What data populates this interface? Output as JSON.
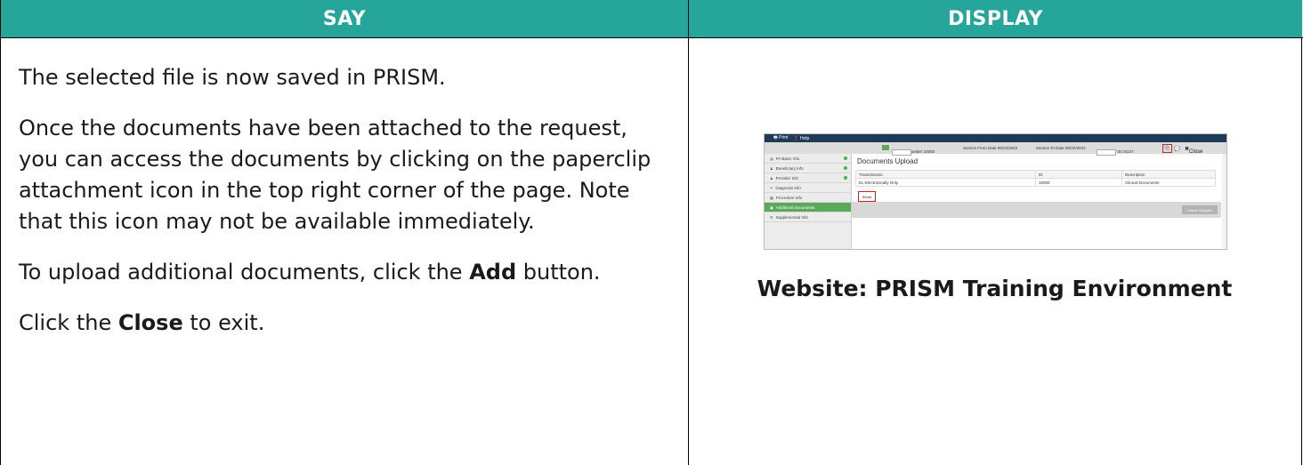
{
  "headers": {
    "say": "SAY",
    "display": "DISPLAY"
  },
  "say": {
    "p1": "The selected file is now saved in PRISM.",
    "p2": "Once the documents have been attached to the request, you can access the documents by clicking on the paperclip attachment icon in the top right corner of the page. Note that this icon may not be available immediately.",
    "p3_pre": "To upload additional documents, click the ",
    "p3_bold": "Add",
    "p3_post": " button.",
    "p4_pre": "Click the ",
    "p4_bold": "Close",
    "p4_post": " to exit."
  },
  "screenshot": {
    "print": "Print",
    "help": "Help",
    "tracking": "Tracking Number 10000",
    "service_from": "Service From Date 08/22/2022",
    "service_to": "Service To Date 08/22/2022",
    "beneficiary": "Beneficiary ID 04127",
    "close": "Close",
    "sidebar": [
      {
        "label": "PA Basic Info",
        "icon": "file-icon",
        "check": true,
        "active": false
      },
      {
        "label": "Beneficiary Info",
        "icon": "user-icon",
        "check": true,
        "active": false
      },
      {
        "label": "Provider Info",
        "icon": "users-icon",
        "check": true,
        "active": false
      },
      {
        "label": "Diagnosis Info",
        "icon": "diagnosis-icon",
        "check": false,
        "active": false
      },
      {
        "label": "Procedure Info",
        "icon": "procedure-icon",
        "check": false,
        "active": false
      },
      {
        "label": "Additional Documents",
        "icon": "documents-icon",
        "check": false,
        "active": true
      },
      {
        "label": "Supplemental Info",
        "icon": "gear-icon",
        "check": false,
        "active": false
      }
    ],
    "title": "Documents Upload",
    "columns": [
      "Transmission",
      "ID",
      "Description"
    ],
    "rows": [
      [
        "EL-Electronically Only",
        "10000",
        "Clinical Documents"
      ]
    ],
    "add": "Add",
    "cancel": "Cancel Request"
  },
  "caption": "Website: PRISM Training Environment",
  "colors": {
    "header_bg": "#26a69a",
    "nav_bar": "#1e3a56",
    "active_item": "#5aa85a",
    "highlight": "#d32020"
  }
}
